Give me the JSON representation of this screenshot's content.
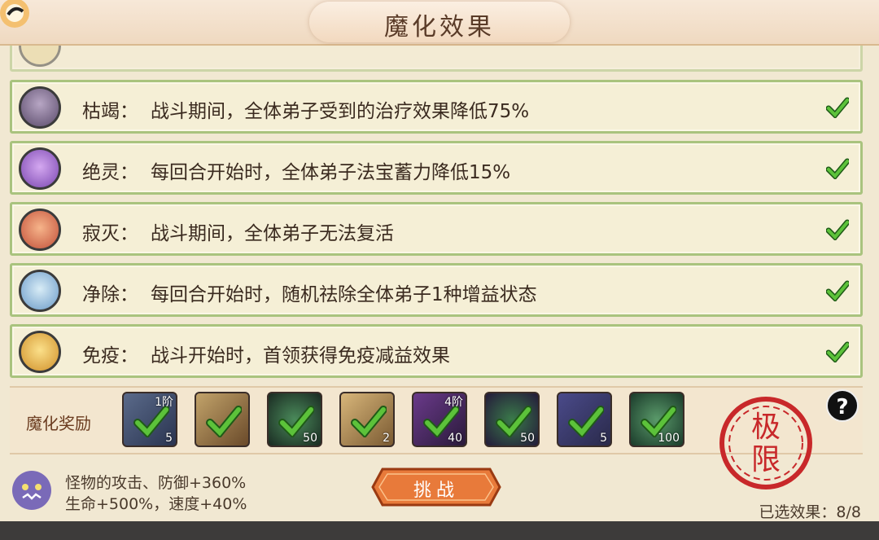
{
  "title": "魔化效果",
  "effects": [
    {
      "name": "枯竭：",
      "desc": "战斗期间，全体弟子受到的治疗效果降低75%",
      "icon": "wither-icon",
      "color": "#6b5a7a"
    },
    {
      "name": "绝灵：",
      "desc": "每回合开始时，全体弟子法宝蓄力降低15%",
      "icon": "spirit-seal-icon",
      "color": "#8a5ab8"
    },
    {
      "name": "寂灭：",
      "desc": "战斗期间，全体弟子无法复活",
      "icon": "extinction-icon",
      "color": "#d06a4a"
    },
    {
      "name": "净除：",
      "desc": "每回合开始时，随机祛除全体弟子1种增益状态",
      "icon": "purge-icon",
      "color": "#6a9ac8"
    },
    {
      "name": "免疫：",
      "desc": "战斗开始时，首领获得免疫减益效果",
      "icon": "immunity-icon",
      "color": "#d8a040"
    }
  ],
  "reward_label": "魔化奖励",
  "rewards": [
    {
      "tier": "1阶",
      "qty": "5",
      "icon": "scroll-reward-icon",
      "color": "#3d4a6a"
    },
    {
      "tier": "",
      "qty": "",
      "icon": "golden-beast-reward-icon",
      "color": "#8a6a3a"
    },
    {
      "tier": "",
      "qty": "50",
      "icon": "green-orb-reward-icon",
      "color": "#2d4a3a"
    },
    {
      "tier": "",
      "qty": "2",
      "icon": "golden-beast-reward-icon",
      "color": "#9a7a4a"
    },
    {
      "tier": "4阶",
      "qty": "40",
      "icon": "gourd-reward-icon",
      "color": "#4a2d5a"
    },
    {
      "tier": "",
      "qty": "50",
      "icon": "green-orb-reward-icon",
      "color": "#3a2d5a"
    },
    {
      "tier": "",
      "qty": "5",
      "icon": "book-reward-icon",
      "color": "#3a3a6a"
    },
    {
      "tier": "",
      "qty": "100",
      "icon": "jade-orb-reward-icon",
      "color": "#2d4a3a"
    }
  ],
  "seal_text": "极限",
  "help_label": "?",
  "bonus_line1": "怪物的攻击、防御+360%",
  "bonus_line2": "生命+500%，速度+40%",
  "challenge_label": "挑战",
  "selected_text": "已选效果：8/8",
  "colors": {
    "check": "#3a8a2a",
    "row_border": "#a9c37e",
    "accent": "#e47a3a"
  }
}
